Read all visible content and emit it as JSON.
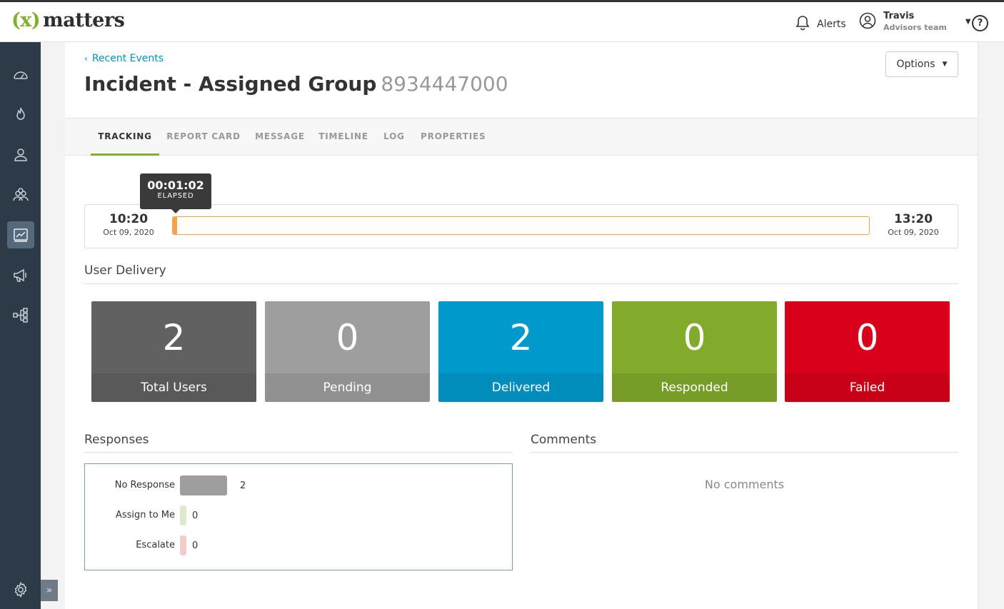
{
  "app": {
    "logo_x": "(x)",
    "logo_word": "matters"
  },
  "header": {
    "alerts_label": "Alerts",
    "user_name": "Travis",
    "user_team": "Advisors team",
    "help_label": "?"
  },
  "sidebar": {
    "items": [
      {
        "icon": "dashboard-icon"
      },
      {
        "icon": "flame-icon"
      },
      {
        "icon": "user-icon"
      },
      {
        "icon": "groups-icon"
      },
      {
        "icon": "reports-icon",
        "active": true
      },
      {
        "icon": "megaphone-icon"
      },
      {
        "icon": "flows-icon"
      }
    ],
    "settings_icon": "gear-icon",
    "expand_label": "»"
  },
  "page": {
    "breadcrumb": "Recent Events",
    "title": "Incident - Assigned Group",
    "event_id": "8934447000",
    "options_label": "Options"
  },
  "tabs": [
    {
      "label": "TRACKING",
      "active": true
    },
    {
      "label": "REPORT CARD"
    },
    {
      "label": "MESSAGE"
    },
    {
      "label": "TIMELINE"
    },
    {
      "label": "LOG"
    },
    {
      "label": "PROPERTIES"
    }
  ],
  "timeline": {
    "start_time": "10:20",
    "start_date": "Oct 09, 2020",
    "end_time": "13:20",
    "end_date": "Oct 09, 2020",
    "elapsed_value": "00:01:02",
    "elapsed_label": "ELAPSED",
    "progress": 0.006
  },
  "user_delivery": {
    "title": "User Delivery",
    "cards": [
      {
        "value": "2",
        "label": "Total Users",
        "color": "#616161"
      },
      {
        "value": "0",
        "label": "Pending",
        "color": "#9e9e9e"
      },
      {
        "value": "2",
        "label": "Delivered",
        "color": "#0099cc"
      },
      {
        "value": "0",
        "label": "Responded",
        "color": "#82ab2c"
      },
      {
        "value": "0",
        "label": "Failed",
        "color": "#d9001b"
      }
    ]
  },
  "responses": {
    "title": "Responses",
    "rows": [
      {
        "label": "No Response",
        "value": "2",
        "color": "#9e9e9e"
      },
      {
        "label": "Assign to Me",
        "value": "0",
        "color": "#dde9cc"
      },
      {
        "label": "Escalate",
        "value": "0",
        "color": "#f4cccc"
      }
    ]
  },
  "comments": {
    "title": "Comments",
    "empty_text": "No comments"
  }
}
